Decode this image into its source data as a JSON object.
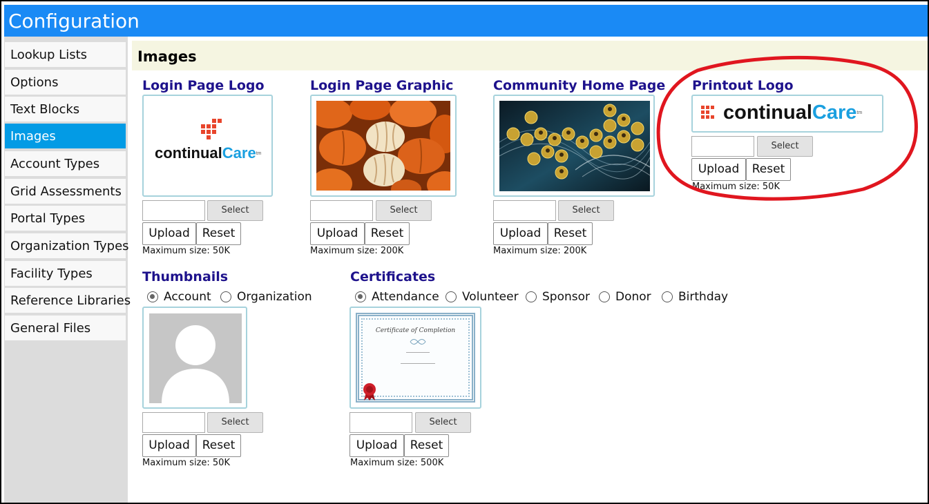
{
  "window": {
    "title": "Configuration"
  },
  "sidebar": {
    "items": [
      {
        "label": "Lookup Lists",
        "active": false
      },
      {
        "label": "Options",
        "active": false
      },
      {
        "label": "Text Blocks",
        "active": false
      },
      {
        "label": "Images",
        "active": true
      },
      {
        "label": "Account Types",
        "active": false
      },
      {
        "label": "Grid Assessments",
        "active": false
      },
      {
        "label": "Portal Types",
        "active": false
      },
      {
        "label": "Organization Types",
        "active": false
      },
      {
        "label": "Facility Types",
        "active": false
      },
      {
        "label": "Reference Libraries",
        "active": false
      },
      {
        "label": "General Files",
        "active": false
      }
    ]
  },
  "main": {
    "section_title": "Images",
    "blocks": {
      "login_logo": {
        "title": "Login Page Logo",
        "max_size": "Maximum size: 50K"
      },
      "login_graphic": {
        "title": "Login Page Graphic",
        "max_size": "Maximum size: 200K"
      },
      "community": {
        "title": "Community Home Page",
        "max_size": "Maximum size: 200K"
      },
      "printout": {
        "title": "Printout Logo",
        "max_size": "Maximum size: 50K"
      },
      "thumbnails": {
        "title": "Thumbnails",
        "max_size": "Maximum size: 50K",
        "options": [
          "Account",
          "Organization"
        ],
        "selected": "Account"
      },
      "certificates": {
        "title": "Certificates",
        "max_size": "Maximum size: 500K",
        "options": [
          "Attendance",
          "Volunteer",
          "Sponsor",
          "Donor",
          "Birthday"
        ],
        "selected": "Attendance",
        "preview_title": "Certificate of Completion"
      }
    },
    "controls": {
      "select_label": "Select",
      "upload_label": "Upload",
      "reset_label": "Reset"
    }
  },
  "logo": {
    "text_dark": "continual",
    "text_accent": "Care",
    "tm": "tm"
  },
  "colors": {
    "titlebar": "#1a8af5",
    "active_nav": "#039be5",
    "heading": "#1e128c",
    "annotation": "#e0161f",
    "logo_blue": "#1ba0e0",
    "logo_red": "#e8452c"
  }
}
